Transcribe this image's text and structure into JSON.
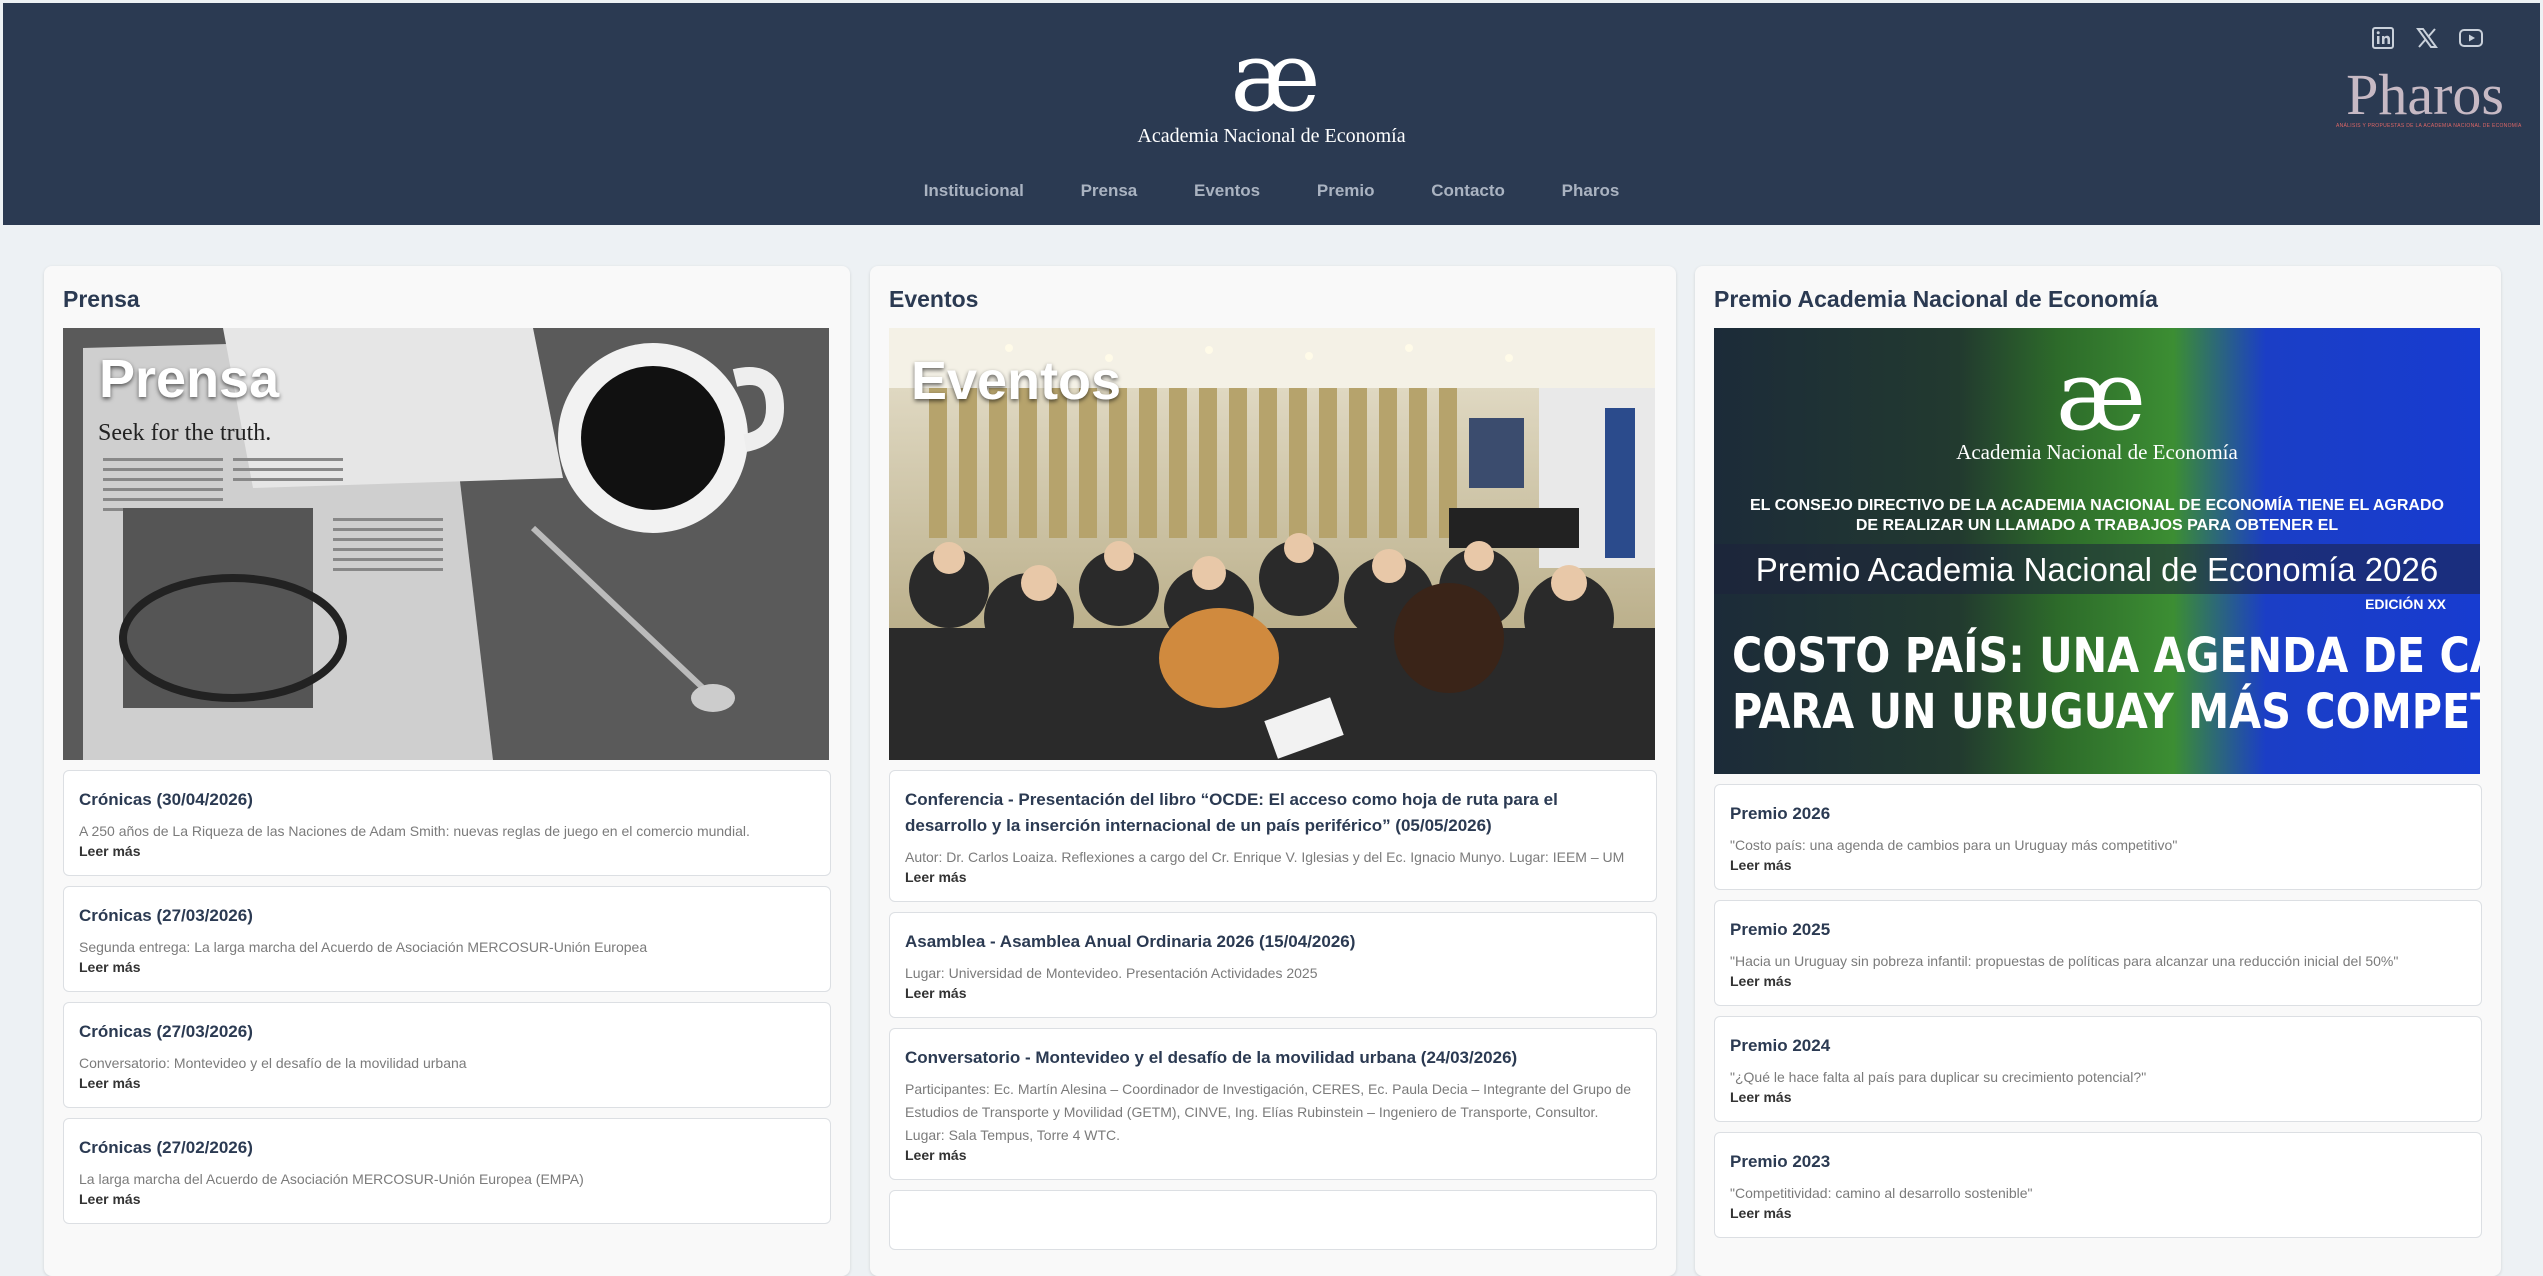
{
  "header": {
    "logo_mark": "æ",
    "logo_name": "Academia Nacional de Economía",
    "nav": [
      "Institucional",
      "Prensa",
      "Eventos",
      "Premio",
      "Contacto",
      "Pharos"
    ],
    "social_icons": [
      "linkedin-icon",
      "x-icon",
      "youtube-icon"
    ],
    "pharos_logo": "Pharos",
    "pharos_tagline": "ANÁLISIS Y PROPUESTAS DE LA ACADEMIA NACIONAL DE ECONOMÍA"
  },
  "prensa": {
    "heading": "Prensa",
    "hero_label": "Prensa",
    "items": [
      {
        "title": "Crónicas (30/04/2026)",
        "desc": "A 250 años de La Riqueza de las Naciones de Adam Smith: nuevas reglas de juego en el comercio mundial.",
        "more": "Leer más"
      },
      {
        "title": "Crónicas (27/03/2026)",
        "desc": "Segunda entrega: La larga marcha del Acuerdo de Asociación MERCOSUR-Unión Europea",
        "more": "Leer más"
      },
      {
        "title": "Crónicas (27/03/2026)",
        "desc": "Conversatorio: Montevideo y el desafío de la movilidad urbana",
        "more": "Leer más"
      },
      {
        "title": "Crónicas (27/02/2026)",
        "desc": "La larga marcha del Acuerdo de Asociación MERCOSUR-Unión Europea (EMPA)",
        "more": "Leer más"
      }
    ]
  },
  "eventos": {
    "heading": "Eventos",
    "hero_label": "Eventos",
    "items": [
      {
        "title": "Conferencia - Presentación del libro “OCDE: El acceso como hoja de ruta para el desarrollo y la inserción internacional de un país periférico” (05/05/2026)",
        "desc": "Autor: Dr. Carlos Loaiza. Reflexiones a cargo del Cr. Enrique V. Iglesias y del Ec. Ignacio Munyo. Lugar: IEEM – UM",
        "more": "Leer más"
      },
      {
        "title": "Asamblea - Asamblea Anual Ordinaria 2026 (15/04/2026)",
        "desc": "Lugar: Universidad de Montevideo. Presentación Actividades 2025",
        "more": "Leer más"
      },
      {
        "title": "Conversatorio - Montevideo y el desafío de la movilidad urbana (24/03/2026)",
        "desc": "Participantes: Ec. Martín Alesina – Coordinador de Investigación, CERES, Ec. Paula Decia – Integrante del Grupo de Estudios de Transporte y Movilidad (GETM), CINVE, Ing. Elías Rubinstein – Ingeniero de Transporte, Consultor. Lugar: Sala Tempus, Torre 4 WTC.",
        "more": "Leer más"
      }
    ]
  },
  "premio": {
    "heading": "Premio Academia Nacional de Economía",
    "banner": {
      "logo_mark": "æ",
      "academia": "Academia Nacional de Economía",
      "intro": "EL CONSEJO DIRECTIVO DE LA ACADEMIA NACIONAL DE ECONOMÍA TIENE EL AGRADO DE REALIZAR UN LLAMADO A TRABAJOS PARA OBTENER EL",
      "title": "Premio Academia Nacional de Economía 2026",
      "edicion": "EDICIÓN XX",
      "slogan_1": "COSTO PAÍS: UNA AGENDA DE CAMBIOS",
      "slogan_2": "PARA UN URUGUAY MÁS COMPETITIVO"
    },
    "items": [
      {
        "title": "Premio 2026",
        "desc": "\"Costo país: una agenda de cambios para un Uruguay más competitivo\"",
        "more": "Leer más"
      },
      {
        "title": "Premio 2025",
        "desc": "\"Hacia un Uruguay sin pobreza infantil: propuestas de políticas para alcanzar una reducción inicial del 50%\"",
        "more": "Leer más"
      },
      {
        "title": "Premio 2024",
        "desc": "\"¿Qué le hace falta al país para duplicar su crecimiento potencial?\"",
        "more": "Leer más"
      },
      {
        "title": "Premio 2023",
        "desc": "\"Competitividad: camino al desarrollo sostenible\"",
        "more": "Leer más"
      }
    ]
  }
}
